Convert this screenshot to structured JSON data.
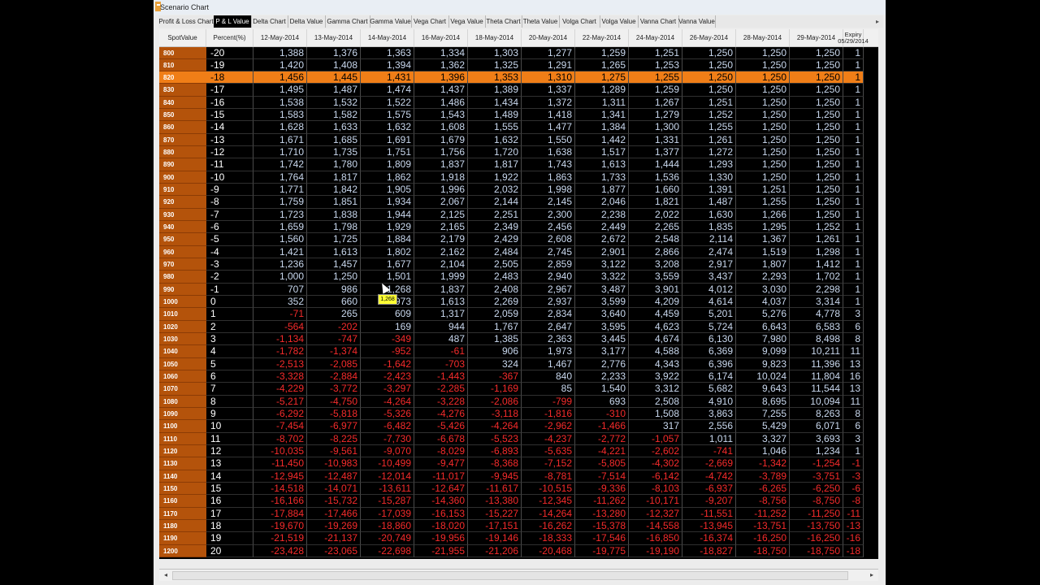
{
  "window": {
    "title": "Scenario Chart"
  },
  "tabs": [
    "Profit & Loss Chart",
    "P & L Value",
    "Delta Chart",
    "Delta Value",
    "Gamma Chart",
    "Gamma Value",
    "Vega Chart",
    "Vega Value",
    "Theta Chart",
    "Theta Value",
    "Volga Chart",
    "Volga Value",
    "Vanna Chart",
    "Vanna Value"
  ],
  "active_tab_index": 1,
  "columns": [
    "SpotValue",
    "Percent(%)",
    "12-May-2014",
    "13-May-2014",
    "14-May-2014",
    "16-May-2014",
    "18-May-2014",
    "20-May-2014",
    "22-May-2014",
    "24-May-2014",
    "26-May-2014",
    "28-May-2014",
    "29-May-2014"
  ],
  "expiry_header": {
    "line1": "Expiry",
    "line2": "05/29/2014"
  },
  "tooltip_text": "1,268",
  "selected_row_index": 2,
  "rows": [
    {
      "spot": "800",
      "pct": "-20",
      "v": [
        "1,388",
        "1,376",
        "1,363",
        "1,334",
        "1,303",
        "1,277",
        "1,259",
        "1,251",
        "1,250",
        "1,250",
        "1,250",
        "1"
      ]
    },
    {
      "spot": "810",
      "pct": "-19",
      "v": [
        "1,420",
        "1,408",
        "1,394",
        "1,362",
        "1,325",
        "1,291",
        "1,265",
        "1,253",
        "1,250",
        "1,250",
        "1,250",
        "1"
      ]
    },
    {
      "spot": "820",
      "pct": "-18",
      "v": [
        "1,456",
        "1,445",
        "1,431",
        "1,396",
        "1,353",
        "1,310",
        "1,275",
        "1,255",
        "1,250",
        "1,250",
        "1,250",
        "1"
      ]
    },
    {
      "spot": "830",
      "pct": "-17",
      "v": [
        "1,495",
        "1,487",
        "1,474",
        "1,437",
        "1,389",
        "1,337",
        "1,289",
        "1,259",
        "1,250",
        "1,250",
        "1,250",
        "1"
      ]
    },
    {
      "spot": "840",
      "pct": "-16",
      "v": [
        "1,538",
        "1,532",
        "1,522",
        "1,486",
        "1,434",
        "1,372",
        "1,311",
        "1,267",
        "1,251",
        "1,250",
        "1,250",
        "1"
      ]
    },
    {
      "spot": "850",
      "pct": "-15",
      "v": [
        "1,583",
        "1,582",
        "1,575",
        "1,543",
        "1,489",
        "1,418",
        "1,341",
        "1,279",
        "1,252",
        "1,250",
        "1,250",
        "1"
      ]
    },
    {
      "spot": "860",
      "pct": "-14",
      "v": [
        "1,628",
        "1,633",
        "1,632",
        "1,608",
        "1,555",
        "1,477",
        "1,384",
        "1,300",
        "1,255",
        "1,250",
        "1,250",
        "1"
      ]
    },
    {
      "spot": "870",
      "pct": "-13",
      "v": [
        "1,671",
        "1,685",
        "1,691",
        "1,679",
        "1,632",
        "1,550",
        "1,442",
        "1,331",
        "1,261",
        "1,250",
        "1,250",
        "1"
      ]
    },
    {
      "spot": "880",
      "pct": "-12",
      "v": [
        "1,710",
        "1,735",
        "1,751",
        "1,756",
        "1,720",
        "1,638",
        "1,517",
        "1,377",
        "1,272",
        "1,250",
        "1,250",
        "1"
      ]
    },
    {
      "spot": "890",
      "pct": "-11",
      "v": [
        "1,742",
        "1,780",
        "1,809",
        "1,837",
        "1,817",
        "1,743",
        "1,613",
        "1,444",
        "1,293",
        "1,250",
        "1,250",
        "1"
      ]
    },
    {
      "spot": "900",
      "pct": "-10",
      "v": [
        "1,764",
        "1,817",
        "1,862",
        "1,918",
        "1,922",
        "1,863",
        "1,733",
        "1,536",
        "1,330",
        "1,250",
        "1,250",
        "1"
      ]
    },
    {
      "spot": "910",
      "pct": "-9",
      "v": [
        "1,771",
        "1,842",
        "1,905",
        "1,996",
        "2,032",
        "1,998",
        "1,877",
        "1,660",
        "1,391",
        "1,251",
        "1,250",
        "1"
      ]
    },
    {
      "spot": "920",
      "pct": "-8",
      "v": [
        "1,759",
        "1,851",
        "1,934",
        "2,067",
        "2,144",
        "2,145",
        "2,046",
        "1,821",
        "1,487",
        "1,255",
        "1,250",
        "1"
      ]
    },
    {
      "spot": "930",
      "pct": "-7",
      "v": [
        "1,723",
        "1,838",
        "1,944",
        "2,125",
        "2,251",
        "2,300",
        "2,238",
        "2,022",
        "1,630",
        "1,266",
        "1,250",
        "1"
      ]
    },
    {
      "spot": "940",
      "pct": "-6",
      "v": [
        "1,659",
        "1,798",
        "1,929",
        "2,165",
        "2,349",
        "2,456",
        "2,449",
        "2,265",
        "1,835",
        "1,295",
        "1,252",
        "1"
      ]
    },
    {
      "spot": "950",
      "pct": "-5",
      "v": [
        "1,560",
        "1,725",
        "1,884",
        "2,179",
        "2,429",
        "2,608",
        "2,672",
        "2,548",
        "2,114",
        "1,367",
        "1,261",
        "1"
      ]
    },
    {
      "spot": "960",
      "pct": "-4",
      "v": [
        "1,421",
        "1,613",
        "1,802",
        "2,162",
        "2,484",
        "2,745",
        "2,901",
        "2,866",
        "2,474",
        "1,519",
        "1,298",
        "1"
      ]
    },
    {
      "spot": "970",
      "pct": "-3",
      "v": [
        "1,236",
        "1,457",
        "1,677",
        "2,104",
        "2,505",
        "2,859",
        "3,122",
        "3,208",
        "2,917",
        "1,807",
        "1,412",
        "1"
      ]
    },
    {
      "spot": "980",
      "pct": "-2",
      "v": [
        "1,000",
        "1,250",
        "1,501",
        "1,999",
        "2,483",
        "2,940",
        "3,322",
        "3,559",
        "3,437",
        "2,293",
        "1,702",
        "1"
      ]
    },
    {
      "spot": "990",
      "pct": "-1",
      "v": [
        "707",
        "986",
        "1,268",
        "1,837",
        "2,408",
        "2,967",
        "3,487",
        "3,901",
        "4,012",
        "3,030",
        "2,298",
        "1"
      ]
    },
    {
      "spot": "1000",
      "pct": "0",
      "v": [
        "352",
        "660",
        "973",
        "1,613",
        "2,269",
        "2,937",
        "3,599",
        "4,209",
        "4,614",
        "4,037",
        "3,314",
        "1"
      ]
    },
    {
      "spot": "1010",
      "pct": "1",
      "v": [
        "-71",
        "265",
        "609",
        "1,317",
        "2,059",
        "2,834",
        "3,640",
        "4,459",
        "5,201",
        "5,276",
        "4,778",
        "3"
      ]
    },
    {
      "spot": "1020",
      "pct": "2",
      "v": [
        "-564",
        "-202",
        "169",
        "944",
        "1,767",
        "2,647",
        "3,595",
        "4,623",
        "5,724",
        "6,643",
        "6,583",
        "6"
      ]
    },
    {
      "spot": "1030",
      "pct": "3",
      "v": [
        "-1,134",
        "-747",
        "-349",
        "487",
        "1,385",
        "2,363",
        "3,445",
        "4,674",
        "6,130",
        "7,980",
        "8,498",
        "8"
      ]
    },
    {
      "spot": "1040",
      "pct": "4",
      "v": [
        "-1,782",
        "-1,374",
        "-952",
        "-61",
        "906",
        "1,973",
        "3,177",
        "4,588",
        "6,369",
        "9,099",
        "10,211",
        "11"
      ]
    },
    {
      "spot": "1050",
      "pct": "5",
      "v": [
        "-2,513",
        "-2,085",
        "-1,642",
        "-703",
        "324",
        "1,467",
        "2,776",
        "4,343",
        "6,396",
        "9,823",
        "11,396",
        "13"
      ]
    },
    {
      "spot": "1060",
      "pct": "6",
      "v": [
        "-3,328",
        "-2,884",
        "-2,423",
        "-1,443",
        "-367",
        "840",
        "2,233",
        "3,922",
        "6,174",
        "10,024",
        "11,804",
        "16"
      ]
    },
    {
      "spot": "1070",
      "pct": "7",
      "v": [
        "-4,229",
        "-3,772",
        "-3,297",
        "-2,285",
        "-1,169",
        "85",
        "1,540",
        "3,312",
        "5,682",
        "9,643",
        "11,544",
        "13"
      ]
    },
    {
      "spot": "1080",
      "pct": "8",
      "v": [
        "-5,217",
        "-4,750",
        "-4,264",
        "-3,228",
        "-2,086",
        "-799",
        "693",
        "2,508",
        "4,910",
        "8,695",
        "10,094",
        "11"
      ]
    },
    {
      "spot": "1090",
      "pct": "9",
      "v": [
        "-6,292",
        "-5,818",
        "-5,326",
        "-4,276",
        "-3,118",
        "-1,816",
        "-310",
        "1,508",
        "3,863",
        "7,255",
        "8,263",
        "8"
      ]
    },
    {
      "spot": "1100",
      "pct": "10",
      "v": [
        "-7,454",
        "-6,977",
        "-6,482",
        "-5,426",
        "-4,264",
        "-2,962",
        "-1,466",
        "317",
        "2,556",
        "5,429",
        "6,071",
        "6"
      ]
    },
    {
      "spot": "1110",
      "pct": "11",
      "v": [
        "-8,702",
        "-8,225",
        "-7,730",
        "-6,678",
        "-5,523",
        "-4,237",
        "-2,772",
        "-1,057",
        "1,011",
        "3,327",
        "3,693",
        "3"
      ]
    },
    {
      "spot": "1120",
      "pct": "12",
      "v": [
        "-10,035",
        "-9,561",
        "-9,070",
        "-8,029",
        "-6,893",
        "-5,635",
        "-4,221",
        "-2,602",
        "-741",
        "1,046",
        "1,234",
        "1"
      ]
    },
    {
      "spot": "1130",
      "pct": "13",
      "v": [
        "-11,450",
        "-10,983",
        "-10,499",
        "-9,477",
        "-8,368",
        "-7,152",
        "-5,805",
        "-4,302",
        "-2,669",
        "-1,342",
        "-1,254",
        "-1"
      ]
    },
    {
      "spot": "1140",
      "pct": "14",
      "v": [
        "-12,945",
        "-12,487",
        "-12,014",
        "-11,017",
        "-9,945",
        "-8,781",
        "-7,514",
        "-6,142",
        "-4,742",
        "-3,789",
        "-3,751",
        "-3"
      ]
    },
    {
      "spot": "1150",
      "pct": "15",
      "v": [
        "-14,518",
        "-14,071",
        "-13,611",
        "-12,647",
        "-11,617",
        "-10,515",
        "-9,336",
        "-8,103",
        "-6,937",
        "-6,265",
        "-6,250",
        "-6"
      ]
    },
    {
      "spot": "1160",
      "pct": "16",
      "v": [
        "-16,166",
        "-15,732",
        "-15,287",
        "-14,360",
        "-13,380",
        "-12,345",
        "-11,262",
        "-10,171",
        "-9,207",
        "-8,756",
        "-8,750",
        "-8"
      ]
    },
    {
      "spot": "1170",
      "pct": "17",
      "v": [
        "-17,884",
        "-17,466",
        "-17,039",
        "-16,153",
        "-15,227",
        "-14,264",
        "-13,280",
        "-12,327",
        "-11,551",
        "-11,252",
        "-11,250",
        "-11"
      ]
    },
    {
      "spot": "1180",
      "pct": "18",
      "v": [
        "-19,670",
        "-19,269",
        "-18,860",
        "-18,020",
        "-17,151",
        "-16,262",
        "-15,378",
        "-14,558",
        "-13,945",
        "-13,751",
        "-13,750",
        "-13"
      ]
    },
    {
      "spot": "1190",
      "pct": "19",
      "v": [
        "-21,519",
        "-21,137",
        "-20,749",
        "-19,956",
        "-19,146",
        "-18,333",
        "-17,546",
        "-16,850",
        "-16,374",
        "-16,250",
        "-16,250",
        "-16"
      ]
    },
    {
      "spot": "1200",
      "pct": "20",
      "v": [
        "-23,428",
        "-23,065",
        "-22,698",
        "-21,955",
        "-21,206",
        "-20,468",
        "-19,775",
        "-19,190",
        "-18,827",
        "-18,750",
        "-18,750",
        "-18"
      ]
    }
  ],
  "colors": {
    "spot_bg": "#b4530b",
    "selected_bg": "#f07e17",
    "positive": "#c9d8ee",
    "negative": "#f52b2b",
    "background": "#000000"
  }
}
